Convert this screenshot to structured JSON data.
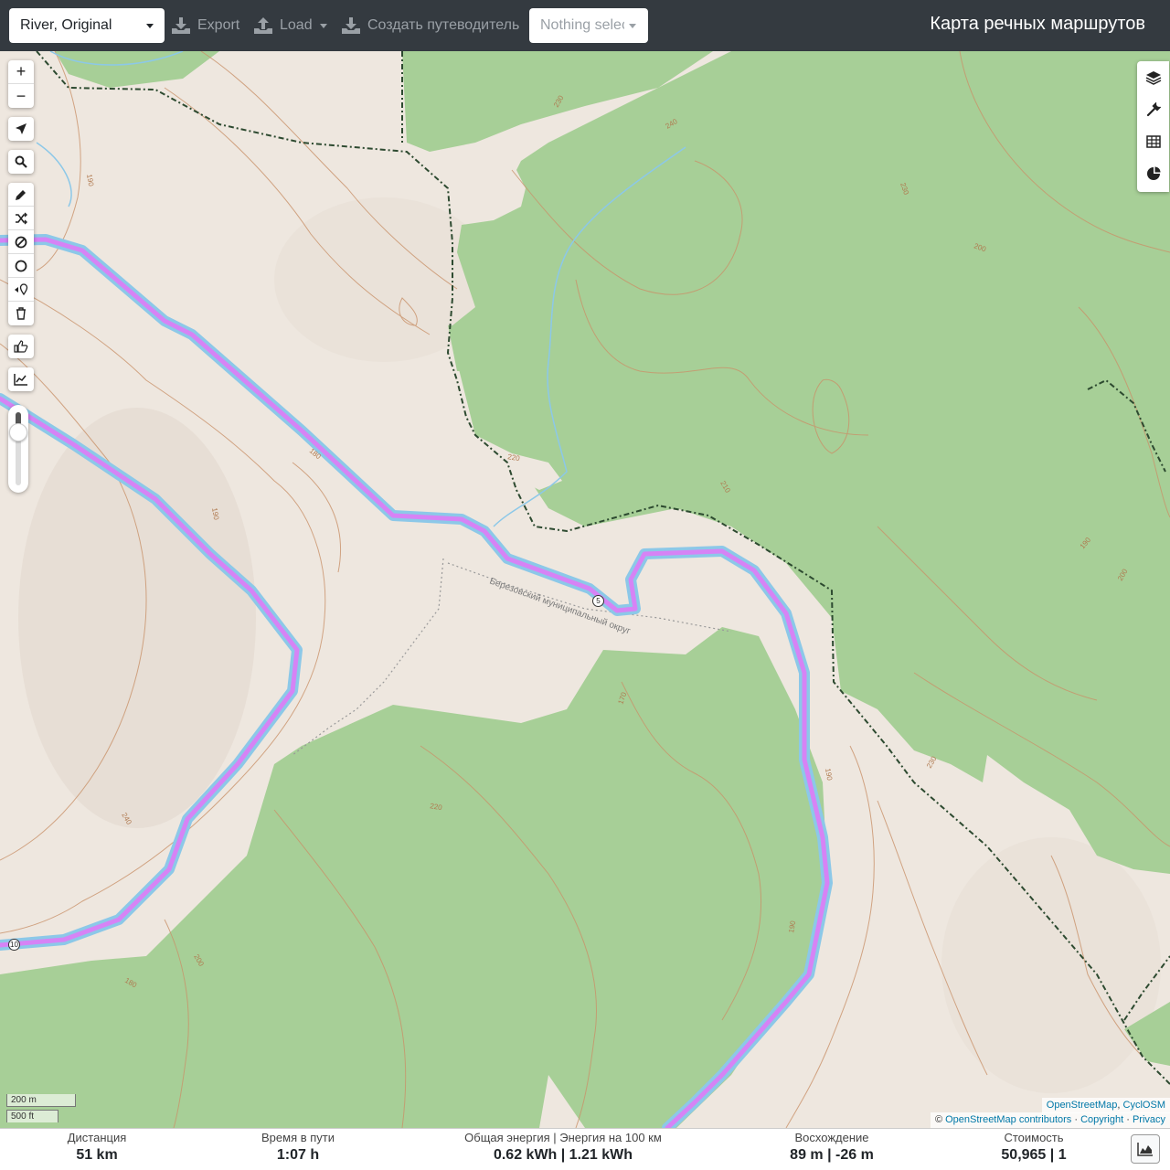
{
  "toolbar": {
    "profile_value": "River, Original",
    "export_label": "Export",
    "load_label": "Load",
    "guide_label": "Создать путеводитель",
    "selection_value": "Nothing selected",
    "app_title": "Карта речных маршрутов"
  },
  "map": {
    "district_label": "Березовский муниципальный округ",
    "route_markers": [
      "5",
      "10"
    ],
    "contour_labels": [
      "230",
      "240",
      "230",
      "190",
      "180",
      "190",
      "200",
      "220",
      "210",
      "190",
      "200",
      "170",
      "190",
      "230",
      "220",
      "240",
      "200",
      "180",
      "190"
    ],
    "colors": {
      "forest": "#a7cf97",
      "land": "#eee7df",
      "route": "#d683f5",
      "river": "#8cc8e8",
      "boundary": "#2d4a30"
    }
  },
  "controls": {
    "zoom_in": "+",
    "zoom_out": "−",
    "icons": [
      "locate-icon",
      "search-icon",
      "pencil-icon",
      "shuffle-icon",
      "no-entry-icon",
      "circle-icon",
      "poi-icon",
      "trash-icon",
      "thumb-icon",
      "elevation-chart-icon"
    ],
    "right_icons": [
      "layers-icon",
      "wrench-icon",
      "table-icon",
      "pie-chart-icon"
    ],
    "zoom_level_fraction": 0.2
  },
  "scale": {
    "metric": "200 m",
    "imperial": "500 ft"
  },
  "attribution": {
    "line1_link1": "OpenStreetMap",
    "line1_sep": ", ",
    "line1_link2": "CyclOSM",
    "line2_prefix": "© ",
    "line2_link1": "OpenStreetMap contributors",
    "line2_sep1": " · ",
    "line2_link2": "Copyright",
    "line2_sep2": " · ",
    "line2_link3": "Privacy"
  },
  "stats": {
    "distance_label": "Дистанция",
    "distance_value": "51 km",
    "time_label": "Время в пути",
    "time_value": "1:07 h",
    "energy_label": "Общая энергия | Энергия на 100 км",
    "energy_value": "0.62 kWh | 1.21 kWh",
    "ascent_label": "Восхождение",
    "ascent_value": "89 m | -26 m",
    "cost_label": "Стоимость",
    "cost_value": "50,965 | 1"
  }
}
